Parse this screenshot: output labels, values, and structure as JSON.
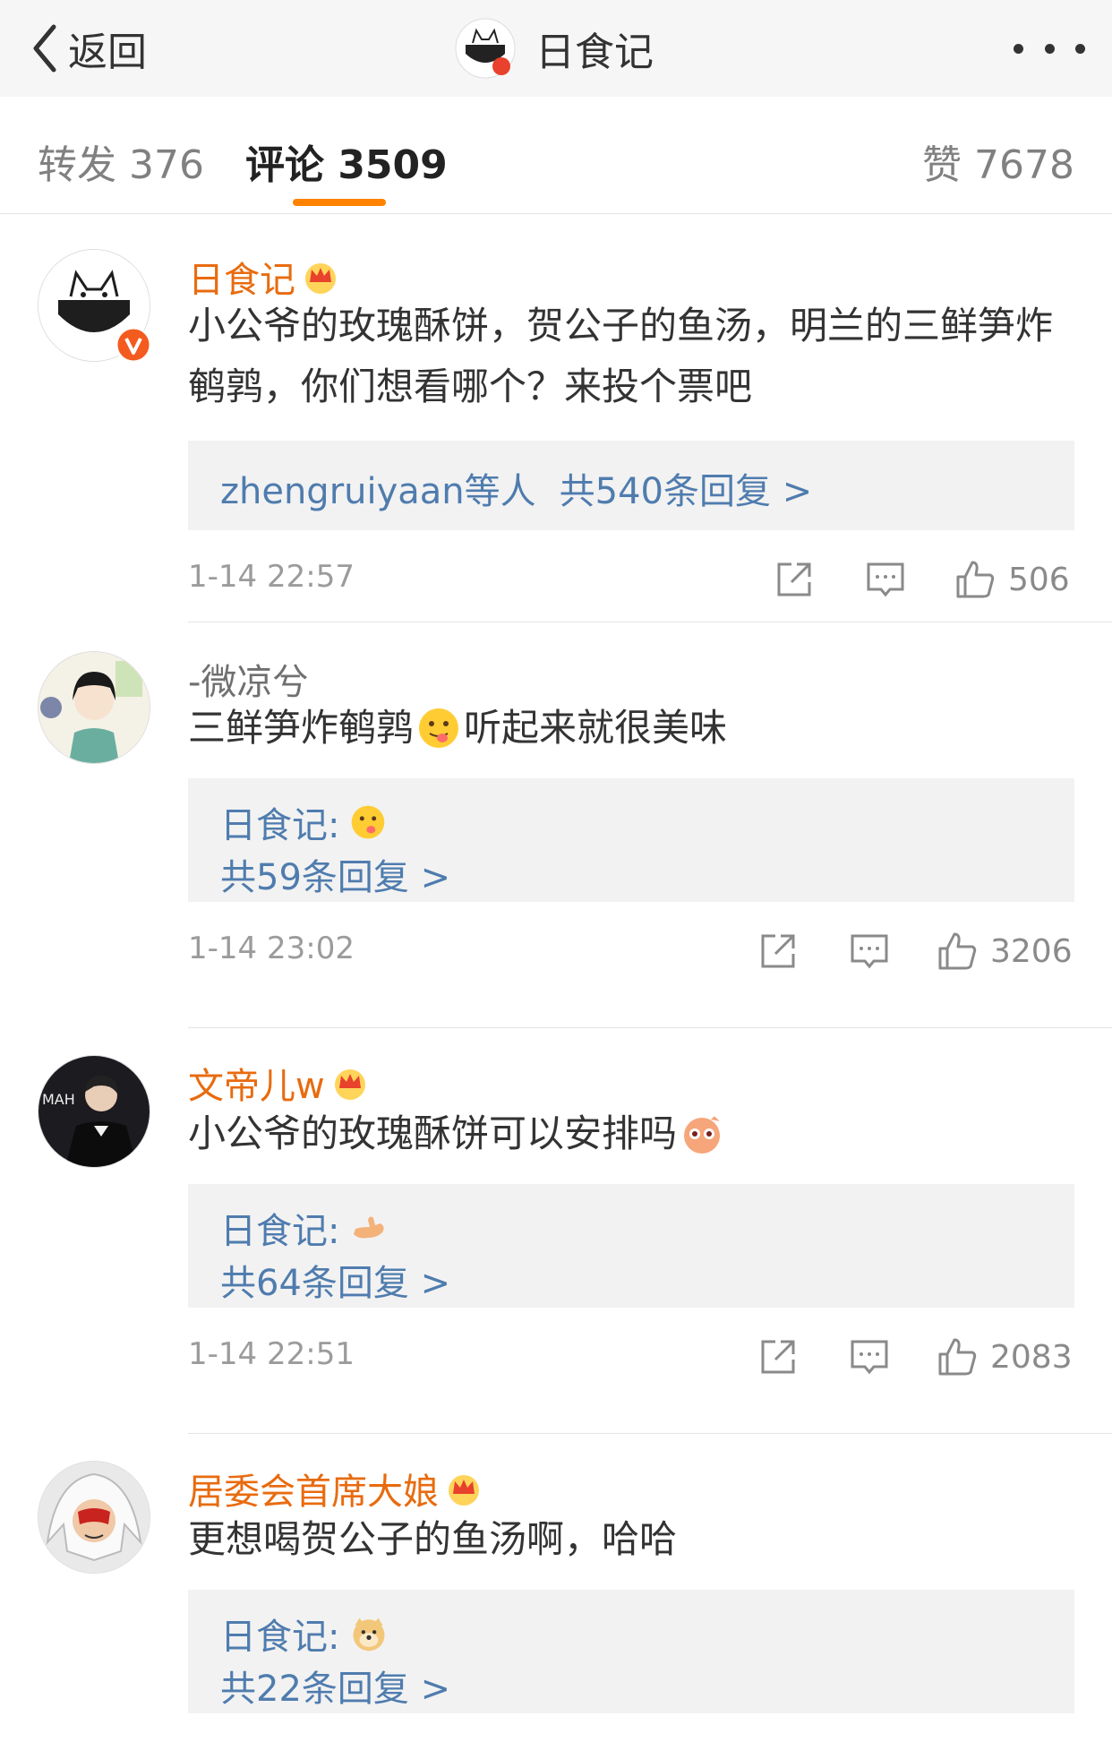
{
  "nav": {
    "back_label": "返回",
    "title": "日食记"
  },
  "tabs": [
    {
      "label": "转发 376"
    },
    {
      "label": "评论 3509"
    },
    {
      "label": "赞 7678"
    }
  ],
  "comments": [
    {
      "user": "日食记",
      "text": "小公爷的玫瑰酥饼，贺公子的鱼汤，明兰的三鲜笋炸鹌鹑，你们想看哪个？来投个票吧",
      "reply_users": "zhengruiyaan等人",
      "reply_count": "共540条回复 >",
      "time": "1-14 22:57",
      "likes": "506"
    },
    {
      "user": "-微凉兮",
      "text_a": "三鲜笋炸鹌鹑",
      "text_b": "听起来就很美味",
      "reply_author": "日食记:",
      "reply_count": "共59条回复 >",
      "time": "1-14 23:02",
      "likes": "3206"
    },
    {
      "user": "文帝儿w",
      "text": "小公爷的玫瑰酥饼可以安排吗",
      "reply_author": "日食记:",
      "reply_count": "共64条回复 >",
      "time": "1-14 22:51",
      "likes": "2083"
    },
    {
      "user": "居委会首席大娘",
      "text": "更想喝贺公子的鱼汤啊，哈哈",
      "reply_author": "日食记:",
      "reply_count": "共22条回复 >"
    }
  ],
  "colors": {
    "accent": "#ff8200",
    "vip_name": "#e86b0f",
    "link": "#4f7cae"
  },
  "icons": [
    "chevron-left-icon",
    "more-icon",
    "crown-icon",
    "verified-icon",
    "share-icon",
    "comment-icon",
    "like-icon",
    "emoji-icon"
  ]
}
